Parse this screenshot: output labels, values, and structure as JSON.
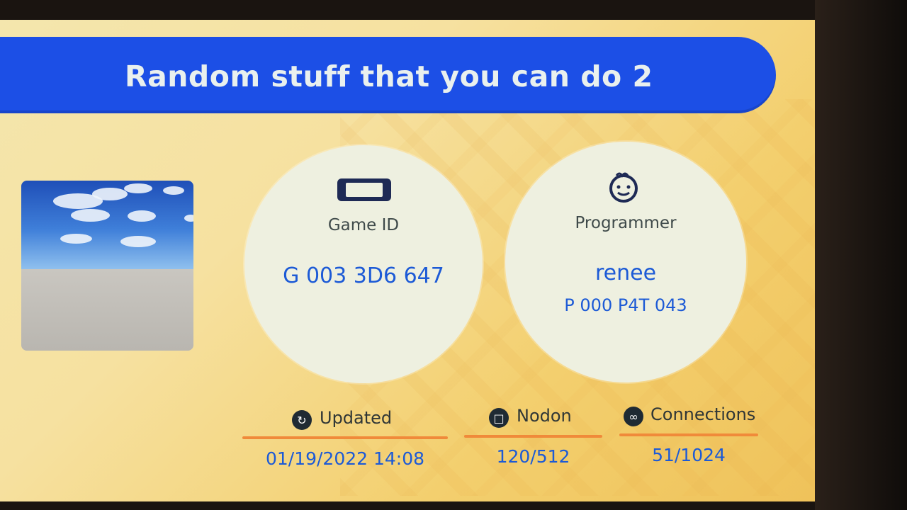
{
  "title": "Random stuff that you can do 2",
  "game": {
    "label": "Game ID",
    "id": "G 003 3D6 647",
    "icon": "console-icon"
  },
  "programmer": {
    "label": "Programmer",
    "name": "renee",
    "id": "P 000 P4T 043",
    "icon": "face-icon"
  },
  "stats": {
    "updated": {
      "label": "Updated",
      "value": "01/19/2022 14:08",
      "icon": "update-icon"
    },
    "nodon": {
      "label": "Nodon",
      "value": "120/512",
      "icon": "nodon-icon"
    },
    "connections": {
      "label": "Connections",
      "value": "51/1024",
      "icon": "connections-icon"
    }
  },
  "colors": {
    "title_bar": "#1c4fe6",
    "value_text": "#1c5ad6",
    "underline": "#f08a3a"
  }
}
